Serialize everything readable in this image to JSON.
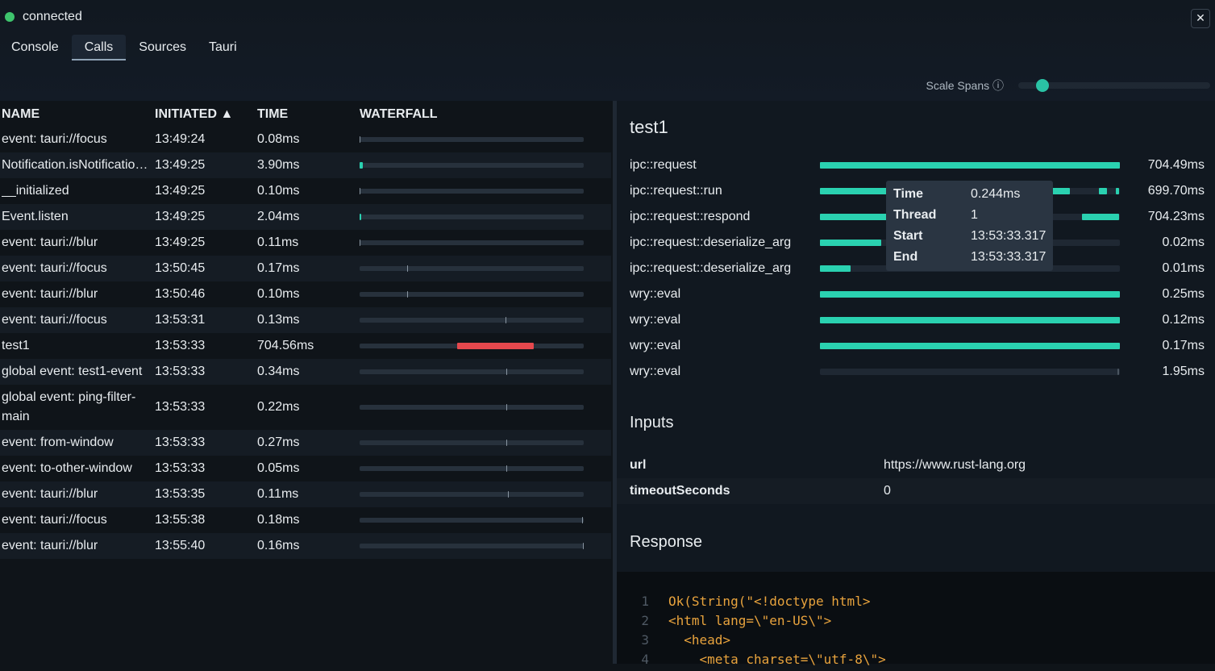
{
  "status": {
    "label": "connected",
    "color": "#3ec46d"
  },
  "close_glyph": "✕",
  "tabs": [
    {
      "label": "Console",
      "active": false
    },
    {
      "label": "Calls",
      "active": true
    },
    {
      "label": "Sources",
      "active": false
    },
    {
      "label": "Tauri",
      "active": false
    }
  ],
  "scale_spans": {
    "label": "Scale Spans ⓘ",
    "value": 0.12
  },
  "table": {
    "headers": {
      "name": "NAME",
      "initiated": "INITIATED ▲",
      "time": "TIME",
      "waterfall": "WATERFALL"
    },
    "rows": [
      {
        "name": "event: tauri://focus",
        "initiated": "13:49:24",
        "time": "0.08ms"
      },
      {
        "name": "Notification.isNotificationPermissionGranted",
        "initiated": "13:49:25",
        "time": "3.90ms"
      },
      {
        "name": "__initialized",
        "initiated": "13:49:25",
        "time": "0.10ms"
      },
      {
        "name": "Event.listen",
        "initiated": "13:49:25",
        "time": "2.04ms"
      },
      {
        "name": "event: tauri://blur",
        "initiated": "13:49:25",
        "time": "0.11ms"
      },
      {
        "name": "event: tauri://focus",
        "initiated": "13:50:45",
        "time": "0.17ms"
      },
      {
        "name": "event: tauri://blur",
        "initiated": "13:50:46",
        "time": "0.10ms"
      },
      {
        "name": "event: tauri://focus",
        "initiated": "13:53:31",
        "time": "0.13ms"
      },
      {
        "name": "test1",
        "initiated": "13:53:33",
        "time": "704.56ms"
      },
      {
        "name": "global event: test1-event",
        "initiated": "13:53:33",
        "time": "0.34ms"
      },
      {
        "name": "global event: ping-filter-main",
        "initiated": "13:53:33",
        "time": "0.22ms"
      },
      {
        "name": "event: from-window",
        "initiated": "13:53:33",
        "time": "0.27ms"
      },
      {
        "name": "event: to-other-window",
        "initiated": "13:53:33",
        "time": "0.05ms"
      },
      {
        "name": "event: tauri://blur",
        "initiated": "13:53:35",
        "time": "0.11ms"
      },
      {
        "name": "event: tauri://focus",
        "initiated": "13:55:38",
        "time": "0.18ms"
      },
      {
        "name": "event: tauri://blur",
        "initiated": "13:55:40",
        "time": "0.16ms"
      }
    ]
  },
  "detail": {
    "title": "test1",
    "spans": [
      {
        "name": "ipc::request",
        "duration": "704.49ms"
      },
      {
        "name": "ipc::request::run",
        "duration": "699.70ms"
      },
      {
        "name": "ipc::request::respond",
        "duration": "704.23ms"
      },
      {
        "name": "ipc::request::deserialize_arg",
        "duration": "0.02ms"
      },
      {
        "name": "ipc::request::deserialize_arg",
        "duration": "0.01ms"
      },
      {
        "name": "wry::eval",
        "duration": "0.25ms"
      },
      {
        "name": "wry::eval",
        "duration": "0.12ms"
      },
      {
        "name": "wry::eval",
        "duration": "0.17ms"
      },
      {
        "name": "wry::eval",
        "duration": "1.95ms"
      }
    ],
    "tooltip": {
      "time_label": "Time",
      "time": "0.244ms",
      "thread_label": "Thread",
      "thread": "1",
      "start_label": "Start",
      "start": "13:53:33.317",
      "end_label": "End",
      "end": "13:53:33.317"
    },
    "inputs_title": "Inputs",
    "inputs": [
      {
        "key": "url",
        "value": "https://www.rust-lang.org"
      },
      {
        "key": "timeoutSeconds",
        "value": "0"
      }
    ],
    "response_title": "Response",
    "code_lines": [
      {
        "n": "1",
        "text": "Ok(String(\"<!doctype html>"
      },
      {
        "n": "2",
        "text": "<html lang=\\\"en-US\\\">"
      },
      {
        "n": "3",
        "text": "  <head>"
      },
      {
        "n": "4",
        "text": "    <meta charset=\\\"utf-8\\\">"
      }
    ]
  },
  "colors": {
    "accent": "#2ad1b0",
    "highlight": "#e5484d",
    "status": "#3ec46d"
  }
}
